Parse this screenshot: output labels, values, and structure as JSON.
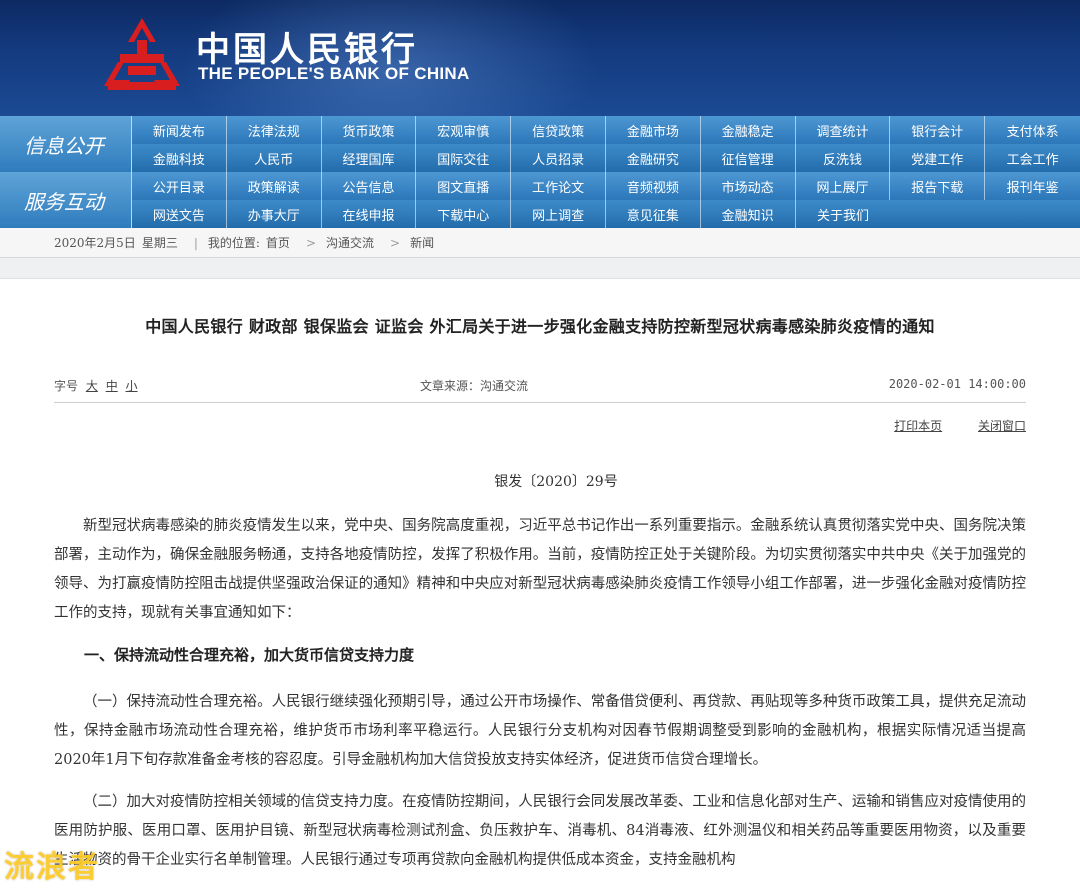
{
  "header": {
    "brand_cn": "中国人民银行",
    "brand_en": "THE PEOPLE'S BANK OF CHINA",
    "logo_icon": "pboc-logo-icon",
    "logo_color": "#d81e1e"
  },
  "nav": {
    "info_label": "信息公开",
    "service_label": "服务互动",
    "info_row1": [
      "新闻发布",
      "法律法规",
      "货币政策",
      "宏观审慎",
      "信贷政策",
      "金融市场",
      "金融稳定",
      "调查统计",
      "银行会计",
      "支付体系"
    ],
    "info_row2": [
      "金融科技",
      "人民币",
      "经理国库",
      "国际交往",
      "人员招录",
      "金融研究",
      "征信管理",
      "反洗钱",
      "党建工作",
      "工会工作"
    ],
    "service_row1": [
      "公开目录",
      "政策解读",
      "公告信息",
      "图文直播",
      "工作论文",
      "音频视频",
      "市场动态",
      "网上展厅",
      "报告下载",
      "报刊年鉴"
    ],
    "service_row2": [
      "网送文告",
      "办事大厅",
      "在线申报",
      "下载中心",
      "网上调查",
      "意见征集",
      "金融知识",
      "关于我们"
    ]
  },
  "breadcrumb": {
    "date": "2020年2月5日",
    "weekday": "星期三",
    "location_label": "我的位置:",
    "home": "首页",
    "level1": "沟通交流",
    "level2": "新闻"
  },
  "article": {
    "title": "中国人民银行 财政部 银保监会 证监会 外汇局关于进一步强化金融支持防控新型冠状病毒感染肺炎疫情的通知",
    "font_size_label": "字号",
    "font_large": "大",
    "font_medium": "中",
    "font_small": "小",
    "source": "文章来源：沟通交流",
    "datetime": "2020-02-01 14:00:00",
    "print": "打印本页",
    "close": "关闭窗口",
    "doc_number": "银发〔2020〕29号",
    "para1": "新型冠状病毒感染的肺炎疫情发生以来，党中央、国务院高度重视，习近平总书记作出一系列重要指示。金融系统认真贯彻落实党中央、国务院决策部署，主动作为，确保金融服务畅通，支持各地疫情防控，发挥了积极作用。当前，疫情防控正处于关键阶段。为切实贯彻落实中共中央《关于加强党的领导、为打赢疫情防控阻击战提供坚强政治保证的通知》精神和中央应对新型冠状病毒感染肺炎疫情工作领导小组工作部署，进一步强化金融对疫情防控工作的支持，现就有关事宜通知如下：",
    "heading1": "一、保持流动性合理充裕，加大货币信贷支持力度",
    "para2": "（一）保持流动性合理充裕。人民银行继续强化预期引导，通过公开市场操作、常备借贷便利、再贷款、再贴现等多种货币政策工具，提供充足流动性，保持金融市场流动性合理充裕，维护货币市场利率平稳运行。人民银行分支机构对因春节假期调整受到影响的金融机构，根据实际情况适当提高2020年1月下旬存款准备金考核的容忍度。引导金融机构加大信贷投放支持实体经济，促进货币信贷合理增长。",
    "para3": "（二）加大对疫情防控相关领域的信贷支持力度。在疫情防控期间，人民银行会同发展改革委、工业和信息化部对生产、运输和销售应对疫情使用的医用防护服、医用口罩、医用护目镜、新型冠状病毒检测试剂盒、负压救护车、消毒机、84消毒液、红外测温仪和相关药品等重要医用物资，以及重要生活物资的骨干企业实行名单制管理。人民银行通过专项再贷款向金融机构提供低成本资金，支持金融机构"
  },
  "watermark": "流浪者"
}
